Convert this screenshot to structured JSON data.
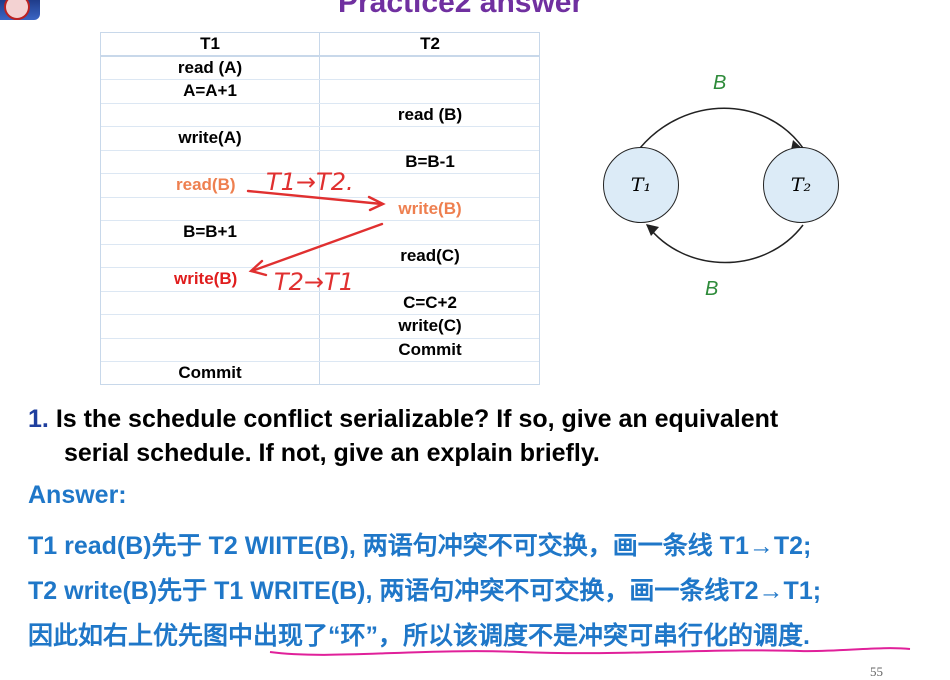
{
  "slide": {
    "title": "Practice2 answer",
    "page_number": "55"
  },
  "schedule": {
    "headers": [
      "T1",
      "T2"
    ],
    "rows": [
      [
        "read (A)",
        ""
      ],
      [
        "A=A+1",
        ""
      ],
      [
        "",
        "read (B)"
      ],
      [
        "write(A)",
        ""
      ],
      [
        "",
        "B=B-1"
      ],
      [
        "read(B)",
        ""
      ],
      [
        "",
        "write(B)"
      ],
      [
        "B=B+1",
        ""
      ],
      [
        "",
        "read(C)"
      ],
      [
        "write(B)",
        ""
      ],
      [
        "",
        "C=C+2"
      ],
      [
        "",
        "write(C)"
      ],
      [
        "",
        "Commit"
      ],
      [
        "Commit",
        ""
      ]
    ]
  },
  "annotations": {
    "first": "T1→T2.",
    "second": "T2→T1"
  },
  "graph": {
    "nodes": [
      "T₁",
      "T₂"
    ],
    "edges": [
      {
        "from": "T1",
        "to": "T2",
        "label": "B"
      },
      {
        "from": "T2",
        "to": "T1",
        "label": "B"
      }
    ]
  },
  "question": {
    "number": "1.",
    "line1": "Is the schedule conflict serializable? If so, give an equivalent",
    "line2": "serial schedule. If not, give an explain briefly."
  },
  "answer": {
    "label": "Answer:",
    "line1": "T1 read(B)先于 T2 WIITE(B), 两语句冲突不可交换，画一条线 T1→T2;",
    "line2": "T2 write(B)先于 T1 WRITE(B), 两语句冲突不可交换，画一条线T2→T1;",
    "line3": "因此如右上优先图中出现了“环”，所以该调度不是冲突可串行化的调度."
  },
  "colors": {
    "title": "#7030a0",
    "answer": "#1f77c8",
    "highlight_orange": "#ee7f4f",
    "highlight_red": "#e01d1d",
    "node_fill": "#dcebf7",
    "edge_label": "#2e8b3a",
    "underline": "#e0209a"
  }
}
